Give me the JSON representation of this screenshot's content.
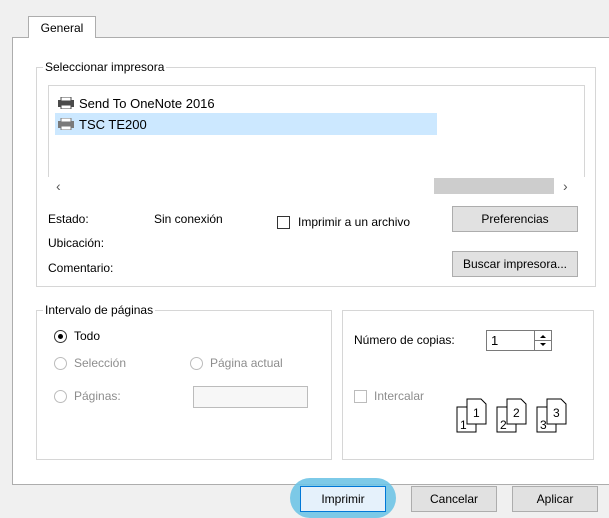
{
  "tabs": [
    {
      "label": "General",
      "active": true
    }
  ],
  "printer_group": {
    "legend": "Seleccionar impresora",
    "printers": [
      {
        "name": "Send To OneNote 2016",
        "icon": "printer-icon",
        "selected": false
      },
      {
        "name": "TSC TE200",
        "icon": "printer-icon",
        "selected": true
      }
    ],
    "scroll_left": "‹",
    "scroll_right": "›",
    "status_label": "Estado:",
    "status_value": "Sin conexión",
    "location_label": "Ubicación:",
    "comment_label": "Comentario:",
    "print_to_file_label": "Imprimir a un archivo",
    "preferences_button": "Preferencias",
    "find_printer_button": "Buscar impresora..."
  },
  "range_group": {
    "legend": "Intervalo de páginas",
    "all_label": "Todo",
    "selection_label": "Selección",
    "current_page_label": "Página actual",
    "pages_label": "Páginas:",
    "selected_option": "all"
  },
  "copies_group": {
    "copies_label": "Número de copias:",
    "copies_value": "1",
    "collate_label": "Intercalar",
    "collate_icon": "collate-pages-icon"
  },
  "footer": {
    "print_button": "Imprimir",
    "cancel_button": "Cancelar",
    "apply_button": "Aplicar"
  },
  "colors": {
    "selection_bg": "#cce8ff",
    "highlight": "#6fc4e6",
    "disabled_text": "#8d8d8d"
  }
}
